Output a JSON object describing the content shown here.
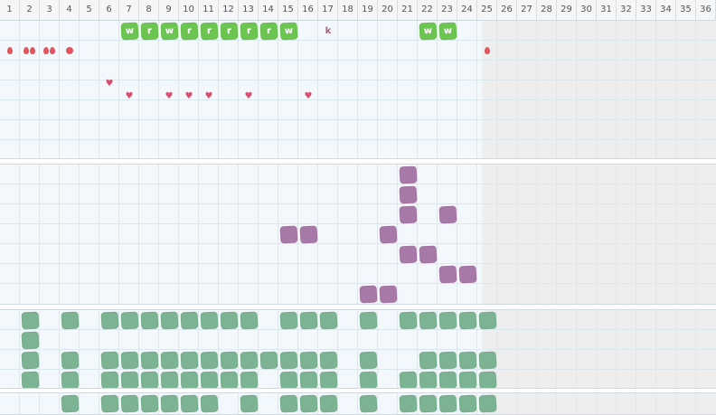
{
  "columns": [
    "1",
    "2",
    "3",
    "4",
    "5",
    "6",
    "7",
    "8",
    "9",
    "10",
    "11",
    "12",
    "13",
    "14",
    "15",
    "16",
    "17",
    "18",
    "19",
    "20",
    "21",
    "22",
    "23",
    "24",
    "25",
    "26",
    "27",
    "28",
    "29",
    "30",
    "31",
    "32",
    "33",
    "34",
    "35",
    "36"
  ],
  "active_columns": 24,
  "colors": {
    "bright_green": "#6cc551",
    "purple": "#a779a6",
    "sage_green": "#7bb393",
    "red": "#e0555f",
    "heart_pink": "#d94f70",
    "k_purple": "#a3607f"
  },
  "panels": [
    {
      "name": "panel-1",
      "rows": 7,
      "marks": [
        {
          "type": "blob",
          "color": "bright_green",
          "col": 7,
          "row": 1,
          "letter": "w"
        },
        {
          "type": "blob",
          "color": "bright_green",
          "col": 8,
          "row": 1,
          "letter": "r"
        },
        {
          "type": "blob",
          "color": "bright_green",
          "col": 9,
          "row": 1,
          "letter": "w"
        },
        {
          "type": "blob",
          "color": "bright_green",
          "col": 10,
          "row": 1,
          "letter": "r"
        },
        {
          "type": "blob",
          "color": "bright_green",
          "col": 11,
          "row": 1,
          "letter": "r"
        },
        {
          "type": "blob",
          "color": "bright_green",
          "col": 12,
          "row": 1,
          "letter": "r"
        },
        {
          "type": "blob",
          "color": "bright_green",
          "col": 13,
          "row": 1,
          "letter": "r"
        },
        {
          "type": "blob",
          "color": "bright_green",
          "col": 14,
          "row": 1,
          "letter": "r"
        },
        {
          "type": "blob",
          "color": "bright_green",
          "col": 15,
          "row": 1,
          "letter": "w"
        },
        {
          "type": "text",
          "color": "k_purple",
          "col": 17,
          "row": 1,
          "letter": "k"
        },
        {
          "type": "blob",
          "color": "bright_green",
          "col": 22,
          "row": 1,
          "letter": "w"
        },
        {
          "type": "blob",
          "color": "bright_green",
          "col": 23,
          "row": 1,
          "letter": "w"
        },
        {
          "type": "drop",
          "color": "red",
          "col": 1,
          "row": 2,
          "count": 1
        },
        {
          "type": "drop",
          "color": "red",
          "col": 2,
          "row": 2,
          "count": 2
        },
        {
          "type": "drop",
          "color": "red",
          "col": 3,
          "row": 2,
          "count": 2
        },
        {
          "type": "dot",
          "color": "red",
          "col": 4,
          "row": 2
        },
        {
          "type": "drop",
          "color": "red",
          "col": 25,
          "row": 2,
          "count": 1
        },
        {
          "type": "heart",
          "color": "heart_pink",
          "col": 6,
          "row": 4,
          "offset": -0.3
        },
        {
          "type": "heart",
          "color": "heart_pink",
          "col": 7,
          "row": 4,
          "offset": 0.3
        },
        {
          "type": "heart",
          "color": "heart_pink",
          "col": 9,
          "row": 4,
          "offset": 0.3
        },
        {
          "type": "heart",
          "color": "heart_pink",
          "col": 10,
          "row": 4,
          "offset": 0.3
        },
        {
          "type": "heart",
          "color": "heart_pink",
          "col": 11,
          "row": 4,
          "offset": 0.3
        },
        {
          "type": "heart",
          "color": "heart_pink",
          "col": 13,
          "row": 4,
          "offset": 0.3
        },
        {
          "type": "heart",
          "color": "heart_pink",
          "col": 16,
          "row": 4,
          "offset": 0.3
        }
      ]
    },
    {
      "name": "panel-2",
      "rows": 7,
      "marks": [
        {
          "type": "blob",
          "color": "purple",
          "col": 21,
          "row": 1
        },
        {
          "type": "blob",
          "color": "purple",
          "col": 21,
          "row": 2
        },
        {
          "type": "blob",
          "color": "purple",
          "col": 21,
          "row": 3
        },
        {
          "type": "blob",
          "color": "purple",
          "col": 23,
          "row": 3
        },
        {
          "type": "blob",
          "color": "purple",
          "col": 15,
          "row": 4
        },
        {
          "type": "blob",
          "color": "purple",
          "col": 16,
          "row": 4
        },
        {
          "type": "blob",
          "color": "purple",
          "col": 20,
          "row": 4
        },
        {
          "type": "blob",
          "color": "purple",
          "col": 21,
          "row": 5
        },
        {
          "type": "blob",
          "color": "purple",
          "col": 22,
          "row": 5
        },
        {
          "type": "blob",
          "color": "purple",
          "col": 23,
          "row": 6
        },
        {
          "type": "blob",
          "color": "purple",
          "col": 24,
          "row": 6
        },
        {
          "type": "blob",
          "color": "purple",
          "col": 19,
          "row": 7
        },
        {
          "type": "blob",
          "color": "purple",
          "col": 20,
          "row": 7
        }
      ]
    },
    {
      "name": "panel-3",
      "rows": 4,
      "marks": [
        {
          "type": "rowfill",
          "color": "sage_green",
          "row": 1,
          "cols": [
            2,
            4,
            6,
            7,
            8,
            9,
            10,
            11,
            12,
            13,
            15,
            16,
            17,
            19,
            21,
            22,
            23,
            24,
            25
          ]
        },
        {
          "type": "rowfill",
          "color": "sage_green",
          "row": 2,
          "cols": [
            2
          ]
        },
        {
          "type": "rowfill",
          "color": "sage_green",
          "row": 3,
          "cols": [
            2,
            4,
            6,
            7,
            8,
            9,
            10,
            11,
            12,
            13,
            14,
            15,
            16,
            17,
            19,
            22,
            23,
            24,
            25
          ]
        },
        {
          "type": "rowfill",
          "color": "sage_green",
          "row": 4,
          "cols": [
            2,
            4,
            6,
            7,
            8,
            9,
            10,
            11,
            12,
            13,
            15,
            16,
            17,
            19,
            21,
            22,
            23,
            24,
            25
          ]
        }
      ]
    },
    {
      "name": "panel-4",
      "rows": 1,
      "marks": [
        {
          "type": "rowfill",
          "color": "sage_green",
          "row": 1,
          "cols": [
            4,
            6,
            7,
            8,
            9,
            10,
            11,
            13,
            15,
            16,
            17,
            19,
            21,
            22,
            23,
            24,
            25
          ]
        }
      ]
    }
  ]
}
